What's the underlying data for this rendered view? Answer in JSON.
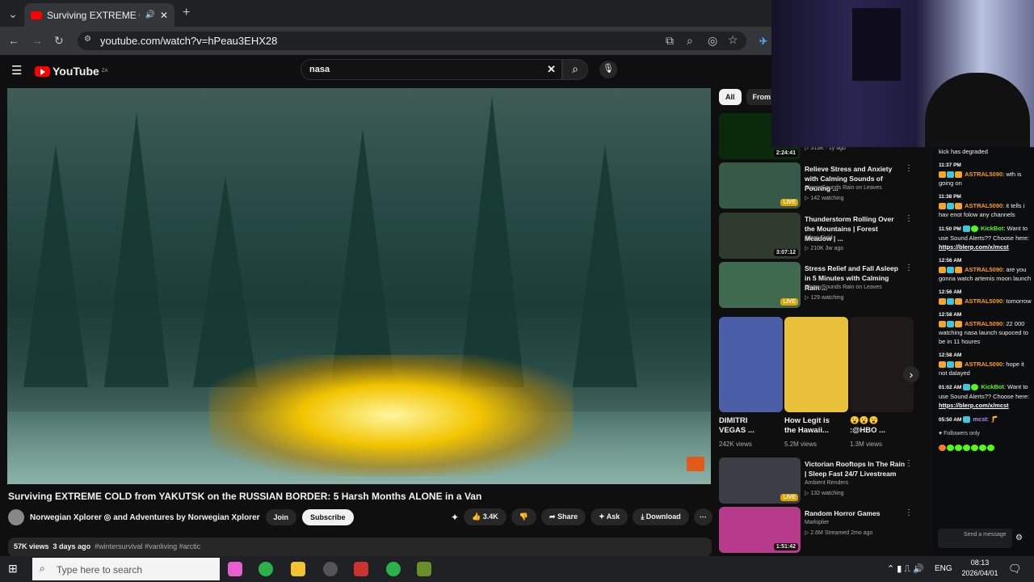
{
  "browser": {
    "tab_title": "Surviving EXTREME COLD fr",
    "url": "youtube.com/watch?v=hPeau3EHX28"
  },
  "youtube": {
    "logo_text": "YouTube",
    "region": "ZA",
    "search_value": "nasa"
  },
  "video": {
    "title": "Surviving EXTREME COLD from YAKUTSK on the RUSSIAN BORDER: 5 Harsh Months ALONE in a Van",
    "channel": "Norwegian Xplorer ◎ and Adventures by Norwegian Xplorer",
    "join": "Join",
    "subscribe": "Subscribe",
    "likes": "3.4K",
    "share": "Share",
    "ask": "Ask",
    "download": "Download",
    "views": "57K views",
    "date": "3 days ago",
    "tags": "#wintersurvival #vanliving #arctic"
  },
  "sidebar": {
    "chips": [
      "All",
      "From N"
    ],
    "recommendations": [
      {
        "title": "",
        "channel": "",
        "meta": "313K · 1y ago",
        "badge": "2:24:41",
        "live": false,
        "color": "#0b2a0b"
      },
      {
        "title": "Relieve Stress and Anxiety with Calming Sounds of Pouring ...",
        "channel": "SleepySounds Rain on Leaves",
        "meta": "142 watching",
        "badge": "LIVE",
        "live": true,
        "color": "#355a48"
      },
      {
        "title": "Thunderstorm Rolling Over the Mountains | Forest Meadow | ...",
        "channel": "Silent Field",
        "meta": "210K  3w ago",
        "badge": "3:07:12",
        "live": false,
        "color": "#2f3b2e"
      },
      {
        "title": "Stress Relief and Fall Asleep in 5 Minutes with Calming Rain ...",
        "channel": "SleepySounds Rain on Leaves",
        "meta": "129 watching",
        "badge": "LIVE",
        "live": true,
        "color": "#3f6a50"
      },
      {
        "title": "Victorian Rooftops In The Rain | Sleep Fast 24/7 Livestream",
        "channel": "Ambient Renders",
        "meta": "132 watching",
        "badge": "LIVE",
        "live": true,
        "color": "#3b3f45"
      },
      {
        "title": "Random Horror Games",
        "channel": "Markiplier",
        "meta": "2.6M  Streamed 2mo ago",
        "badge": "1:51:42",
        "live": false,
        "color": "#b83a8a"
      }
    ],
    "shorts": [
      {
        "title": "DIMITRI VEGAS ...",
        "views": "242K views",
        "color": "#4a5fa8"
      },
      {
        "title": "How Legit is the Hawaii...",
        "views": "5.2M views",
        "color": "#e8c03a"
      },
      {
        "title": "😮😮😮 :@HBO ...",
        "views": "1.3M views",
        "color": "#1f1a17"
      }
    ]
  },
  "chat": {
    "first": "kick has degraded",
    "messages": [
      {
        "time": "11:37 PM",
        "user": "ASTRAL5090",
        "text": "wth is going on",
        "link": ""
      },
      {
        "time": "11:38 PM",
        "user": "ASTRAL5090",
        "text": "it tells i hav enot folow any channels",
        "link": ""
      },
      {
        "time": "11:50 PM",
        "user": "KickBot",
        "text": "Want to use Sound Alerts?? Choose here:",
        "link": "https://blerp.com/x/mcst"
      },
      {
        "time": "12:56 AM",
        "user": "ASTRAL5090",
        "text": "are you gonna watch artemis moon launch",
        "link": ""
      },
      {
        "time": "12:56 AM",
        "user": "ASTRAL5090",
        "text": "tomorrow",
        "link": ""
      },
      {
        "time": "12:58 AM",
        "user": "ASTRAL5090",
        "text": "22 000 watching nasa launch supoced to be in 11 houres",
        "link": ""
      },
      {
        "time": "12:58 AM",
        "user": "ASTRAL5090",
        "text": "hope it not dalayed",
        "link": ""
      },
      {
        "time": "01:02 AM",
        "user": "KickBot",
        "text": "Want to use Sound Alerts?? Choose here:",
        "link": "https://blerp.com/x/mcst"
      },
      {
        "time": "05:50 AM",
        "user": "mcst",
        "text": "",
        "link": ""
      }
    ],
    "followers_only": "Followers only",
    "send_placeholder": "Send a message"
  },
  "taskbar": {
    "search_placeholder": "Type here to search",
    "lang": "ENG",
    "time": "08:13",
    "date": "2026/04/01"
  }
}
